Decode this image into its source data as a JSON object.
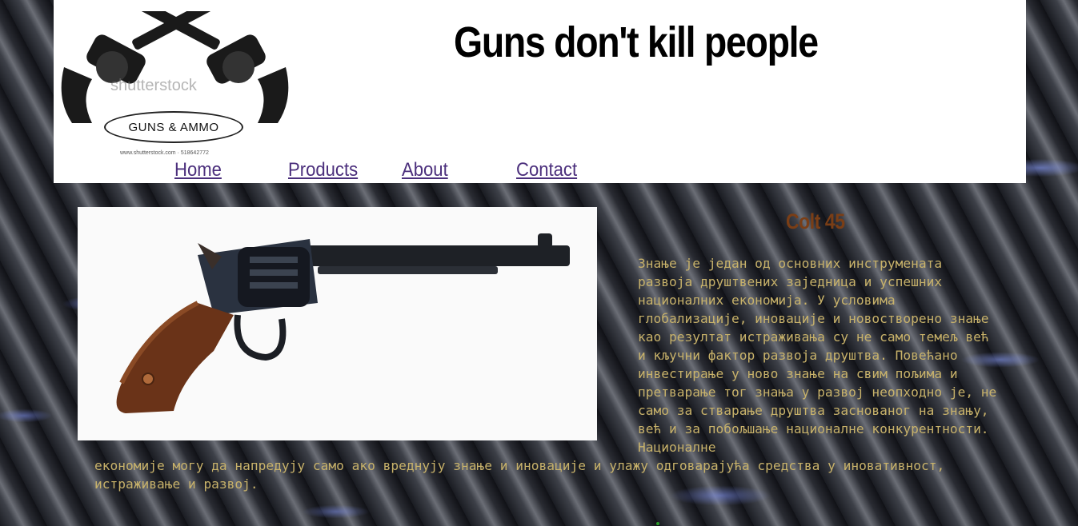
{
  "header": {
    "title": "Guns don't kill people",
    "logo": {
      "badge": "GUNS & AMMO",
      "watermark": "shutterstock",
      "footer": "www.shutterstock.com · 518642772"
    }
  },
  "nav": {
    "items": [
      {
        "label": "Home"
      },
      {
        "label": "Products"
      },
      {
        "label": "About"
      },
      {
        "label": "Contact"
      }
    ]
  },
  "product": {
    "name": "Colt 45",
    "description_right": "Знање је један од основних инструмената развоја друштвених заједница и успешних националних економија. У условима глобализације, иновације и новостворено знање као резултат истраживања су не само темељ већ и кључни фактор развоја друштва. Повећано инвестирање у ново знање на свим пољима и претварање тог знања у развој неопходно је, не само за стварање друштва заснованог на знању, већ и за побољшање националне конкурентности. Националне",
    "description_bottom": "економије могу да напредују само ако вреднују знање и иновације и улажу одговарајућа средства у иновативност, истраживање и развој."
  },
  "colors": {
    "nav_link": "#4b2f7c",
    "product_name": "#7a3e16",
    "body_text": "#c8b26a",
    "header_bg": "#ffffff"
  }
}
